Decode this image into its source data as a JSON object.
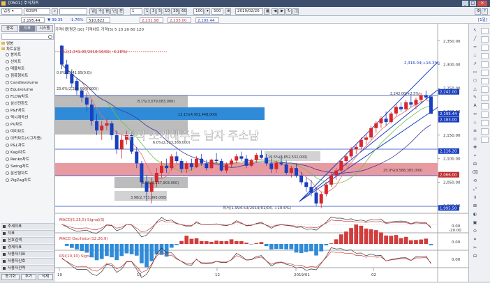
{
  "window": {
    "title": "[0501] 주식차트"
  },
  "toolbar": {
    "mode": "업종",
    "code": "KOSPI",
    "periods": [
      "일",
      "주",
      "월",
      "년"
    ],
    "minute_label": "1",
    "intervals": [
      "1",
      "3",
      "5",
      "10",
      "30",
      "60"
    ],
    "count": "100",
    "zoom_total": "500",
    "date": "2019/02/26"
  },
  "pricebar": {
    "price": "2,195.44",
    "change": "39.35",
    "change_pct": "-1.76%",
    "volume": "510,822",
    "open": "2,231.98",
    "high": "2,233.00",
    "low": "2,195.44",
    "right_label": "[1일]"
  },
  "left_panel": {
    "tabs": [
      "종목",
      "지표",
      "시스템"
    ],
    "tree_root": "엄봉",
    "tree_group": "차트유형",
    "items": [
      "봉차트",
      "선차트",
      "매물차트",
      "점폭형차트",
      "Candlevolume",
      "Equivolume",
      "FLOW차트",
      "삼선전환도",
      "P&F차트",
      "역시계곡선",
      "PV차트",
      "미미차트",
      "이퀴차트(시고저종)",
      "P&L차트",
      "Kagi차트",
      "Renko차트",
      "Swing차트",
      "분산형차트",
      "ZigZag차트"
    ],
    "sections": [
      "추세지표",
      "지표",
      "신호검색",
      "경제지표",
      "사용자지표",
      "사용자신호",
      "사용자전략"
    ],
    "bottom_buttons": [
      "동기화",
      "추가",
      "삭제"
    ]
  },
  "chart": {
    "legend": "가격이동평균(10)  가격차트  가격(5)  5  10  20  60  120",
    "watermark": "주식 소개해주는 남자 주소남",
    "high_annotation": "최고(2,341.95/2018/10/02, -6.28%)",
    "low_annotation": "최저(1,994.53/2019/01/04, +10.6%)",
    "target_annotation": "2,316.04(+16.3%)",
    "trend_annotation": "2,242.00(+2.5%)",
    "fib_levels": [
      {
        "label": "0.0%(2,341.95(0.0))",
        "value": 2341.95
      },
      {
        "label": "23.6%(2,284.09(0.000))",
        "value": 2284.09
      },
      {
        "label": "38.2%(2,248.53(0.000))",
        "value": 2248.53
      },
      {
        "label": "0.000(2,178.00(0.000))",
        "value": 2178.0
      },
      {
        "label": "61.8%(2,117.00(0.000))",
        "value": 2117.0
      },
      {
        "label": "8.1%(2,079.00(0.000))",
        "value": 2079.0
      }
    ],
    "band_labels": {
      "blue": "13.1%(4,951,448,000)",
      "pink": "25.0%(9,588,385,000)",
      "gray1": "8.1%(3,079,083,000)",
      "gray2": "8.5%(3,227,903,000)",
      "gray3": "3.98(2,773,066,000)",
      "gray4": "19.5%(6,852,532,000)",
      "mid": "6.0%(2,333,368,000)"
    },
    "price_axis": [
      "2,350.00",
      "2,300.00",
      "2,250.00",
      "2,200.00",
      "2,150.00",
      "2,100.00",
      "2,050.00",
      "2,000.00"
    ],
    "price_tags": {
      "last": "2,195.44",
      "blue1": "2,242.00",
      "blue2": "2,183.00",
      "blue3": "2,116.20",
      "pink": "2,066.00",
      "bottom": "1,995.50"
    },
    "macd_label": "MACD(5,25,5)  Signal(3)",
    "macd_axis": [
      "0.00",
      "-20.00"
    ],
    "osc_label": "MACD Oscillator(12,26,9)",
    "osc_axis": [
      "0.00"
    ],
    "rsi_label": "RSI(10,10)  Signal(3)",
    "rsi_axis": [
      "0.00"
    ],
    "date_axis": [
      "10",
      "11",
      "12",
      "2019/01",
      "02"
    ]
  },
  "chart_data": {
    "type": "candlestick",
    "title": "",
    "ylim": [
      1990,
      2360
    ],
    "categories_axis": [
      "10",
      "11",
      "12",
      "2019/01",
      "02"
    ],
    "candles": [
      [
        2340,
        2341,
        2290,
        2300
      ],
      [
        2300,
        2310,
        2270,
        2280
      ],
      [
        2280,
        2290,
        2250,
        2260
      ],
      [
        2265,
        2270,
        2235,
        2245
      ],
      [
        2245,
        2250,
        2220,
        2230
      ],
      [
        2230,
        2240,
        2200,
        2215
      ],
      [
        2215,
        2225,
        2170,
        2180
      ],
      [
        2180,
        2195,
        2150,
        2160
      ],
      [
        2160,
        2180,
        2140,
        2170
      ],
      [
        2170,
        2185,
        2160,
        2175
      ],
      [
        2175,
        2180,
        2140,
        2150
      ],
      [
        2150,
        2160,
        2110,
        2120
      ],
      [
        2120,
        2150,
        2100,
        2140
      ],
      [
        2140,
        2160,
        2130,
        2150
      ],
      [
        2150,
        2155,
        2110,
        2115
      ],
      [
        2115,
        2125,
        2080,
        2090
      ],
      [
        2090,
        2095,
        2040,
        2050
      ],
      [
        2050,
        2065,
        2010,
        2030
      ],
      [
        2030,
        2060,
        2005,
        2050
      ],
      [
        2050,
        2080,
        2040,
        2070
      ],
      [
        2070,
        2095,
        2060,
        2085
      ],
      [
        2085,
        2100,
        2070,
        2080
      ],
      [
        2080,
        2110,
        2075,
        2105
      ],
      [
        2105,
        2115,
        2090,
        2095
      ],
      [
        2095,
        2100,
        2070,
        2078
      ],
      [
        2078,
        2095,
        2070,
        2090
      ],
      [
        2090,
        2100,
        2075,
        2082
      ],
      [
        2082,
        2105,
        2080,
        2100
      ],
      [
        2100,
        2110,
        2085,
        2090
      ],
      [
        2090,
        2098,
        2075,
        2080
      ],
      [
        2080,
        2100,
        2078,
        2098
      ],
      [
        2098,
        2112,
        2090,
        2095
      ],
      [
        2095,
        2100,
        2072,
        2075
      ],
      [
        2075,
        2092,
        2070,
        2088
      ],
      [
        2088,
        2100,
        2082,
        2096
      ],
      [
        2096,
        2110,
        2090,
        2105
      ],
      [
        2105,
        2115,
        2095,
        2100
      ],
      [
        2100,
        2108,
        2080,
        2085
      ],
      [
        2085,
        2100,
        2082,
        2097
      ],
      [
        2097,
        2112,
        2092,
        2108
      ],
      [
        2108,
        2118,
        2100,
        2102
      ],
      [
        2102,
        2110,
        2085,
        2090
      ],
      [
        2090,
        2100,
        2070,
        2078
      ],
      [
        2078,
        2095,
        2070,
        2092
      ],
      [
        2092,
        2105,
        2085,
        2088
      ],
      [
        2088,
        2096,
        2066,
        2070
      ],
      [
        2070,
        2085,
        2060,
        2080
      ],
      [
        2080,
        2090,
        2060,
        2064
      ],
      [
        2064,
        2072,
        2045,
        2050
      ],
      [
        2050,
        2060,
        2030,
        2040
      ],
      [
        2040,
        2055,
        2020,
        2028
      ],
      [
        2028,
        2040,
        2000,
        2005
      ],
      [
        2005,
        2030,
        1995,
        2025
      ],
      [
        2025,
        2050,
        2020,
        2045
      ],
      [
        2045,
        2070,
        2040,
        2065
      ],
      [
        2065,
        2080,
        2055,
        2075
      ],
      [
        2075,
        2100,
        2070,
        2095
      ],
      [
        2095,
        2110,
        2085,
        2105
      ],
      [
        2105,
        2125,
        2100,
        2120
      ],
      [
        2120,
        2130,
        2110,
        2125
      ],
      [
        2125,
        2145,
        2120,
        2140
      ],
      [
        2140,
        2150,
        2130,
        2145
      ],
      [
        2145,
        2170,
        2140,
        2165
      ],
      [
        2165,
        2180,
        2155,
        2175
      ],
      [
        2175,
        2190,
        2165,
        2185
      ],
      [
        2185,
        2200,
        2170,
        2178
      ],
      [
        2178,
        2200,
        2175,
        2196
      ],
      [
        2196,
        2215,
        2190,
        2210
      ],
      [
        2210,
        2220,
        2200,
        2205
      ],
      [
        2205,
        2225,
        2200,
        2220
      ],
      [
        2220,
        2235,
        2210,
        2215
      ],
      [
        2215,
        2230,
        2205,
        2225
      ],
      [
        2225,
        2240,
        2220,
        2235
      ],
      [
        2235,
        2245,
        2225,
        2230
      ],
      [
        2231.98,
        2233,
        2195.44,
        2195.44
      ]
    ],
    "series": [
      {
        "name": "20",
        "color": "#e07070"
      },
      {
        "name": "60",
        "color": "#6cbf4a"
      },
      {
        "name": "120",
        "color": "#3a3a9e"
      }
    ]
  }
}
